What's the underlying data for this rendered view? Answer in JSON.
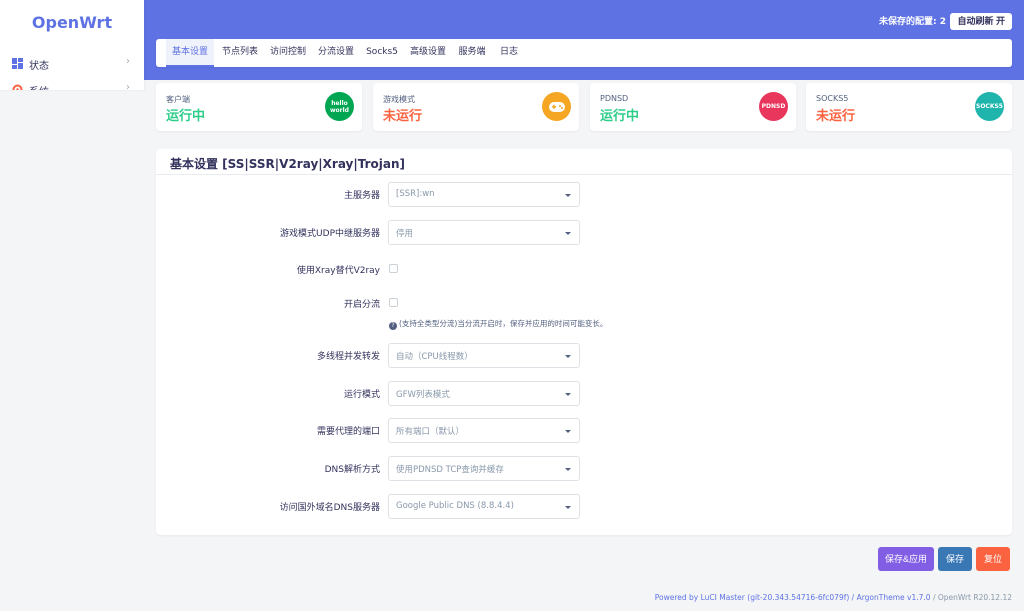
{
  "sidebar": {
    "brand": "OpenWrt",
    "items": [
      {
        "label": "状态",
        "icon": "dashboard-icon"
      },
      {
        "label": "系统",
        "icon": "gear-icon"
      }
    ]
  },
  "header": {
    "unsaved": "未保存的配置: 2",
    "auto_refresh": "自动刷新 开"
  },
  "tabs": [
    "基本设置",
    "节点列表",
    "访问控制",
    "分流设置",
    "Socks5",
    "高级设置",
    "服务端",
    "日志"
  ],
  "status_cards": [
    {
      "label": "客户端",
      "status": "运行中",
      "icon_text": "hello world",
      "color": "#00a651"
    },
    {
      "label": "游戏模式",
      "status": "未运行",
      "icon_text": "",
      "color": "#f5a623"
    },
    {
      "label": "PDNSD",
      "status": "运行中",
      "icon_text": "PDNSD",
      "color": "#e8365d"
    },
    {
      "label": "SOCKS5",
      "status": "未运行",
      "icon_text": "SOCKS5",
      "color": "#1fb5ad"
    }
  ],
  "panel": {
    "title": "基本设置 [SS|SSR|V2ray|Xray|Trojan]",
    "fields": [
      {
        "label": "主服务器",
        "value": "[SSR]:wn"
      },
      {
        "label": "游戏模式UDP中继服务器",
        "value": "停用"
      },
      {
        "label": "使用Xray替代V2ray"
      },
      {
        "label": "开启分流"
      },
      {
        "label": "多线程并发转发",
        "value": "自动（CPU线程数）"
      },
      {
        "label": "运行模式",
        "value": "GFW列表模式"
      },
      {
        "label": "需要代理的端口",
        "value": "所有端口（默认）"
      },
      {
        "label": "DNS解析方式",
        "value": "使用PDNSD TCP查询并缓存"
      },
      {
        "label": "访问国外域名DNS服务器",
        "value": "Google Public DNS (8.8.4.4)"
      }
    ],
    "help_text": "(支持全类型分流)当分流开启时，保存并应用的时间可能变长。"
  },
  "actions": {
    "save_apply": "保存&应用",
    "save": "保存",
    "reset": "复位"
  },
  "footer": {
    "powered": "Powered by LuCI Master (git-20.343.54716-6fc079f)",
    "theme": " / ArgonTheme v1.7.0",
    "version": " / OpenWrt R20.12.12"
  },
  "colors": {
    "accent": "#5e72e4",
    "running": "#2dce89",
    "stopped": "#fb6340",
    "save_apply": "#825ee4",
    "save": "#3a78b5",
    "reset": "#fb6340"
  }
}
